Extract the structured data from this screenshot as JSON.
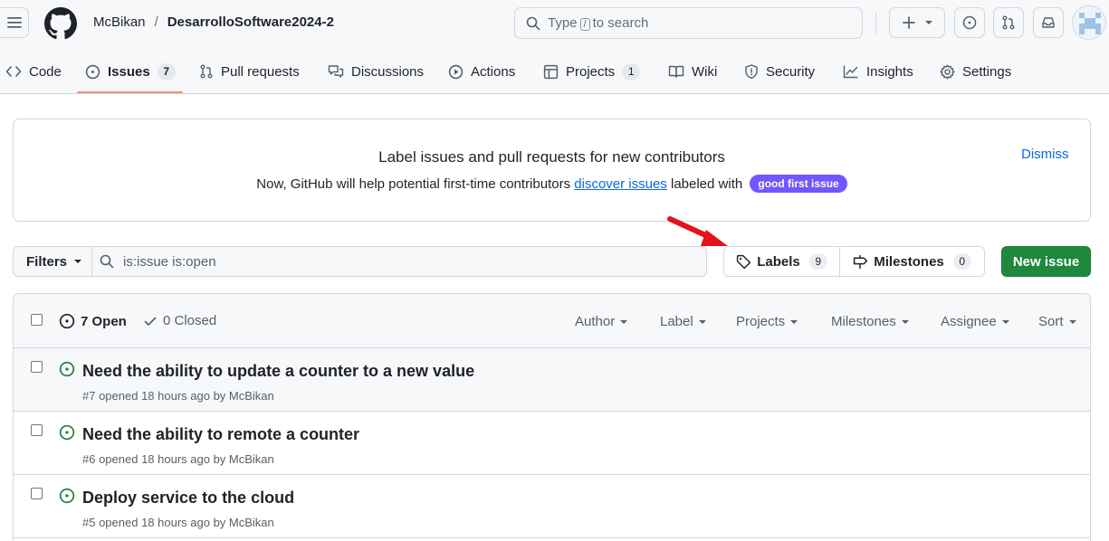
{
  "header": {
    "owner": "McBikan",
    "separator": "/",
    "repo": "DesarrolloSoftware2024-2",
    "search": {
      "prefix": "Type",
      "key": "/",
      "suffix": "to search"
    }
  },
  "tabs": [
    {
      "label": "Code"
    },
    {
      "label": "Issues",
      "count": "7"
    },
    {
      "label": "Pull requests"
    },
    {
      "label": "Discussions"
    },
    {
      "label": "Actions"
    },
    {
      "label": "Projects",
      "count": "1"
    },
    {
      "label": "Wiki"
    },
    {
      "label": "Security"
    },
    {
      "label": "Insights"
    },
    {
      "label": "Settings"
    }
  ],
  "banner": {
    "title": "Label issues and pull requests for new contributors",
    "text_before": "Now, GitHub will help potential first-time contributors",
    "link": "discover issues",
    "text_after": "labeled with",
    "pill": "good first issue",
    "dismiss": "Dismiss"
  },
  "toolbar": {
    "filters": "Filters",
    "query": "is:issue is:open",
    "labels": "Labels",
    "labels_count": "9",
    "milestones": "Milestones",
    "milestones_count": "0",
    "new_issue": "New issue"
  },
  "list_header": {
    "open": "7 Open",
    "closed": "0 Closed",
    "sort_menus": [
      "Author",
      "Label",
      "Projects",
      "Milestones",
      "Assignee",
      "Sort"
    ]
  },
  "issues": [
    {
      "title": "Need the ability to update a counter to a new value",
      "meta": "#7 opened 18 hours ago by McBikan"
    },
    {
      "title": "Need the ability to remote a counter",
      "meta": "#6 opened 18 hours ago by McBikan"
    },
    {
      "title": "Deploy service to the cloud",
      "meta": "#5 opened 18 hours ago by McBikan"
    }
  ],
  "colors": {
    "accent_green": "#1f883d",
    "open_icon": "#1a7f37",
    "link": "#0969da",
    "pill_bg": "#7057ff",
    "tab_underline": "#fd8c73",
    "annotation_arrow": "#e3121b"
  }
}
